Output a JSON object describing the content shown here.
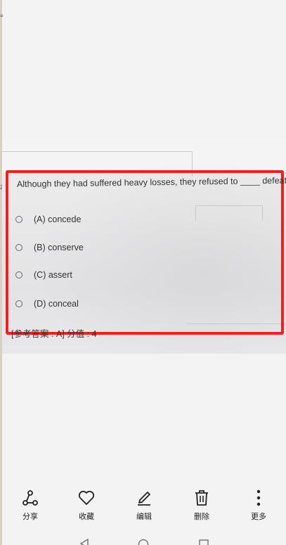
{
  "question": {
    "text": "Although they had suffered heavy losses, they refused to ____ defeat"
  },
  "options": [
    {
      "label": "(A) concede"
    },
    {
      "label": "(B) conserve"
    },
    {
      "label": "(C) assert"
    },
    {
      "label": "(D) conceal"
    }
  ],
  "answer": {
    "text": "[参考答案 : A]   分值 : 4"
  },
  "toolbar": {
    "share": "分享",
    "favorite": "收藏",
    "edit": "编辑",
    "delete": "删除",
    "more": "更多"
  },
  "colors": {
    "highlight": "#f11f1f",
    "background": "#f3f3f3"
  }
}
